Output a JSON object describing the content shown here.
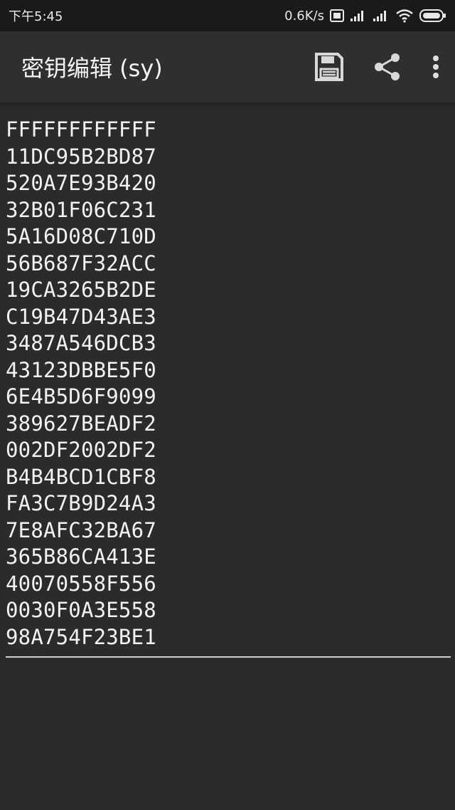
{
  "status_bar": {
    "time": "下午5:45",
    "network_speed": "0.6K/s",
    "icons": [
      "hd-icon",
      "signal-icon",
      "signal-icon",
      "wifi-icon",
      "battery-icon"
    ]
  },
  "app_bar": {
    "title": "密钥编辑 (sy)",
    "actions": [
      "save-icon",
      "share-icon",
      "overflow-menu-icon"
    ]
  },
  "editor": {
    "lines": [
      "FFFFFFFFFFFF",
      "11DC95B2BD87",
      "520A7E93B420",
      "32B01F06C231",
      "5A16D08C710D",
      "56B687F32ACC",
      "19CA3265B2DE",
      "C19B47D43AE3",
      "3487A546DCB3",
      "43123DBBE5F0",
      "6E4B5D6F9099",
      "389627BEADF2",
      "002DF2002DF2",
      "B4B4BCD1CBF8",
      "FA3C7B9D24A3",
      "7E8AFC32BA67",
      "365B86CA413E",
      "40070558F556",
      "0030F0A3E558",
      "98A754F23BE1"
    ]
  },
  "colors": {
    "background": "#2b2b2b",
    "app_bar": "#2f2f2f",
    "status_bar": "#1a1a1a",
    "text": "#f2f2f2"
  }
}
